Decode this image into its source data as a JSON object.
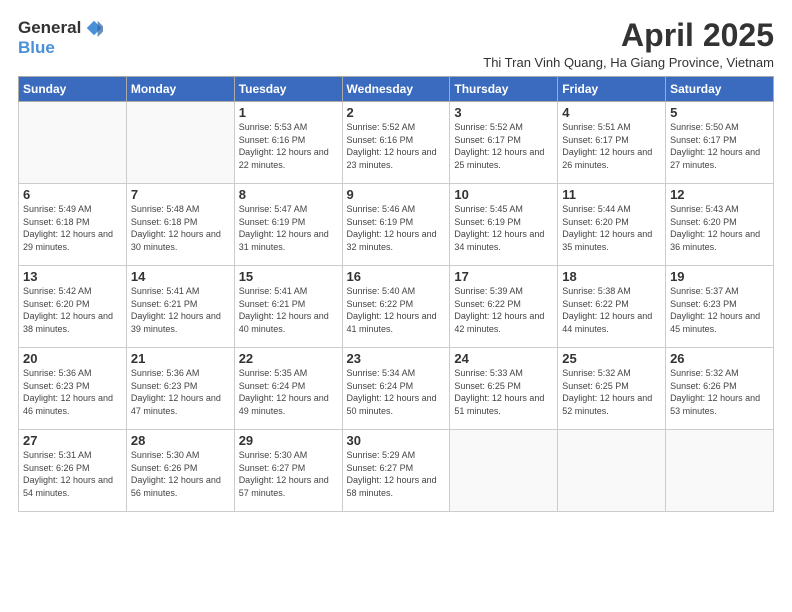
{
  "logo": {
    "general": "General",
    "blue": "Blue"
  },
  "title": "April 2025",
  "subtitle": "Thi Tran Vinh Quang, Ha Giang Province, Vietnam",
  "weekdays": [
    "Sunday",
    "Monday",
    "Tuesday",
    "Wednesday",
    "Thursday",
    "Friday",
    "Saturday"
  ],
  "weeks": [
    [
      {
        "day": "",
        "info": ""
      },
      {
        "day": "",
        "info": ""
      },
      {
        "day": "1",
        "info": "Sunrise: 5:53 AM\nSunset: 6:16 PM\nDaylight: 12 hours and 22 minutes."
      },
      {
        "day": "2",
        "info": "Sunrise: 5:52 AM\nSunset: 6:16 PM\nDaylight: 12 hours and 23 minutes."
      },
      {
        "day": "3",
        "info": "Sunrise: 5:52 AM\nSunset: 6:17 PM\nDaylight: 12 hours and 25 minutes."
      },
      {
        "day": "4",
        "info": "Sunrise: 5:51 AM\nSunset: 6:17 PM\nDaylight: 12 hours and 26 minutes."
      },
      {
        "day": "5",
        "info": "Sunrise: 5:50 AM\nSunset: 6:17 PM\nDaylight: 12 hours and 27 minutes."
      }
    ],
    [
      {
        "day": "6",
        "info": "Sunrise: 5:49 AM\nSunset: 6:18 PM\nDaylight: 12 hours and 29 minutes."
      },
      {
        "day": "7",
        "info": "Sunrise: 5:48 AM\nSunset: 6:18 PM\nDaylight: 12 hours and 30 minutes."
      },
      {
        "day": "8",
        "info": "Sunrise: 5:47 AM\nSunset: 6:19 PM\nDaylight: 12 hours and 31 minutes."
      },
      {
        "day": "9",
        "info": "Sunrise: 5:46 AM\nSunset: 6:19 PM\nDaylight: 12 hours and 32 minutes."
      },
      {
        "day": "10",
        "info": "Sunrise: 5:45 AM\nSunset: 6:19 PM\nDaylight: 12 hours and 34 minutes."
      },
      {
        "day": "11",
        "info": "Sunrise: 5:44 AM\nSunset: 6:20 PM\nDaylight: 12 hours and 35 minutes."
      },
      {
        "day": "12",
        "info": "Sunrise: 5:43 AM\nSunset: 6:20 PM\nDaylight: 12 hours and 36 minutes."
      }
    ],
    [
      {
        "day": "13",
        "info": "Sunrise: 5:42 AM\nSunset: 6:20 PM\nDaylight: 12 hours and 38 minutes."
      },
      {
        "day": "14",
        "info": "Sunrise: 5:41 AM\nSunset: 6:21 PM\nDaylight: 12 hours and 39 minutes."
      },
      {
        "day": "15",
        "info": "Sunrise: 5:41 AM\nSunset: 6:21 PM\nDaylight: 12 hours and 40 minutes."
      },
      {
        "day": "16",
        "info": "Sunrise: 5:40 AM\nSunset: 6:22 PM\nDaylight: 12 hours and 41 minutes."
      },
      {
        "day": "17",
        "info": "Sunrise: 5:39 AM\nSunset: 6:22 PM\nDaylight: 12 hours and 42 minutes."
      },
      {
        "day": "18",
        "info": "Sunrise: 5:38 AM\nSunset: 6:22 PM\nDaylight: 12 hours and 44 minutes."
      },
      {
        "day": "19",
        "info": "Sunrise: 5:37 AM\nSunset: 6:23 PM\nDaylight: 12 hours and 45 minutes."
      }
    ],
    [
      {
        "day": "20",
        "info": "Sunrise: 5:36 AM\nSunset: 6:23 PM\nDaylight: 12 hours and 46 minutes."
      },
      {
        "day": "21",
        "info": "Sunrise: 5:36 AM\nSunset: 6:23 PM\nDaylight: 12 hours and 47 minutes."
      },
      {
        "day": "22",
        "info": "Sunrise: 5:35 AM\nSunset: 6:24 PM\nDaylight: 12 hours and 49 minutes."
      },
      {
        "day": "23",
        "info": "Sunrise: 5:34 AM\nSunset: 6:24 PM\nDaylight: 12 hours and 50 minutes."
      },
      {
        "day": "24",
        "info": "Sunrise: 5:33 AM\nSunset: 6:25 PM\nDaylight: 12 hours and 51 minutes."
      },
      {
        "day": "25",
        "info": "Sunrise: 5:32 AM\nSunset: 6:25 PM\nDaylight: 12 hours and 52 minutes."
      },
      {
        "day": "26",
        "info": "Sunrise: 5:32 AM\nSunset: 6:26 PM\nDaylight: 12 hours and 53 minutes."
      }
    ],
    [
      {
        "day": "27",
        "info": "Sunrise: 5:31 AM\nSunset: 6:26 PM\nDaylight: 12 hours and 54 minutes."
      },
      {
        "day": "28",
        "info": "Sunrise: 5:30 AM\nSunset: 6:26 PM\nDaylight: 12 hours and 56 minutes."
      },
      {
        "day": "29",
        "info": "Sunrise: 5:30 AM\nSunset: 6:27 PM\nDaylight: 12 hours and 57 minutes."
      },
      {
        "day": "30",
        "info": "Sunrise: 5:29 AM\nSunset: 6:27 PM\nDaylight: 12 hours and 58 minutes."
      },
      {
        "day": "",
        "info": ""
      },
      {
        "day": "",
        "info": ""
      },
      {
        "day": "",
        "info": ""
      }
    ]
  ]
}
